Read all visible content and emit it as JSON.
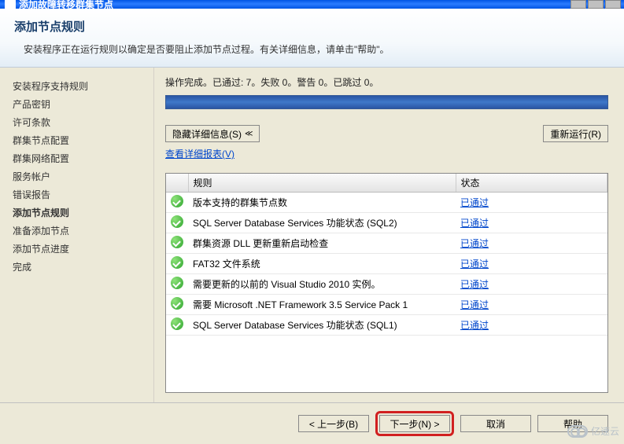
{
  "titlebar": {
    "text": "添加故障转移群集节点"
  },
  "header": {
    "title": "添加节点规则",
    "subtitle": "安装程序正在运行规则以确定是否要阻止添加节点过程。有关详细信息，请单击\"帮助\"。"
  },
  "sidebar": {
    "items": [
      {
        "label": "安装程序支持规则",
        "active": false
      },
      {
        "label": "产品密钥",
        "active": false
      },
      {
        "label": "许可条款",
        "active": false
      },
      {
        "label": "群集节点配置",
        "active": false
      },
      {
        "label": "群集网络配置",
        "active": false
      },
      {
        "label": "服务帐户",
        "active": false
      },
      {
        "label": "错误报告",
        "active": false
      },
      {
        "label": "添加节点规则",
        "active": true
      },
      {
        "label": "准备添加节点",
        "active": false
      },
      {
        "label": "添加节点进度",
        "active": false
      },
      {
        "label": "完成",
        "active": false
      }
    ]
  },
  "main": {
    "status": "操作完成。已通过: 7。失败 0。警告 0。已跳过 0。",
    "hide_details": "隐藏详细信息(S)",
    "rerun": "重新运行(R)",
    "view_report": "查看详细报表(V)",
    "table": {
      "headers": {
        "icon": "",
        "rule": "规则",
        "status": "状态"
      },
      "pass_label": "已通过",
      "rows": [
        {
          "rule": "版本支持的群集节点数"
        },
        {
          "rule": "SQL Server Database Services 功能状态 (SQL2)"
        },
        {
          "rule": "群集资源 DLL 更新重新启动检查"
        },
        {
          "rule": "FAT32 文件系统"
        },
        {
          "rule": "需要更新的以前的 Visual Studio 2010 实例。"
        },
        {
          "rule": "需要 Microsoft .NET Framework 3.5 Service Pack 1"
        },
        {
          "rule": "SQL Server Database Services 功能状态 (SQL1)"
        }
      ]
    }
  },
  "footer": {
    "back": "< 上一步(B)",
    "next": "下一步(N) >",
    "cancel": "取消",
    "help": "帮助"
  },
  "watermark": "亿速云"
}
